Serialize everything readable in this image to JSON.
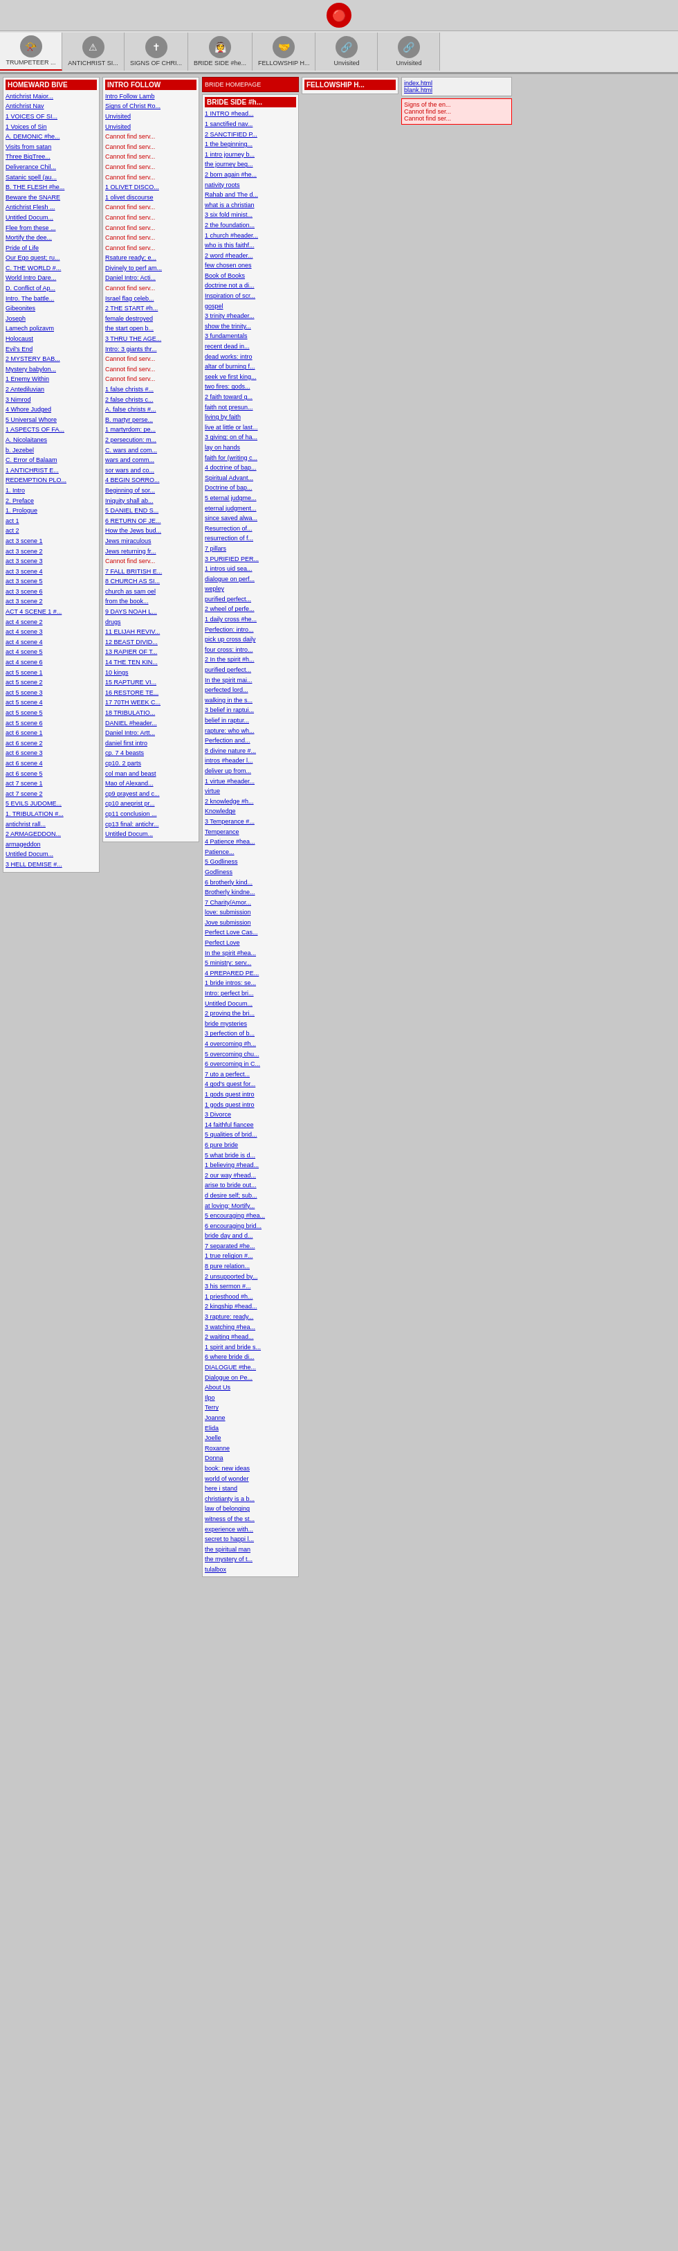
{
  "logo": {
    "symbol": "🔴"
  },
  "nav": {
    "items": [
      {
        "id": "trumpeteer",
        "label": "TRUMPETEER ...",
        "icon": "📯"
      },
      {
        "id": "antichrist",
        "label": "ANTICHRIST SI...",
        "icon": "⚠"
      },
      {
        "id": "signs",
        "label": "SIGNS OF CHRI...",
        "icon": "✝"
      },
      {
        "id": "bride_side",
        "label": "BRIDE SIDE #he...",
        "icon": "👰"
      },
      {
        "id": "fellowship",
        "label": "FELLOWSHIP H...",
        "icon": "🤝"
      },
      {
        "id": "unvisited1",
        "label": "Unvisited",
        "icon": "🔗"
      },
      {
        "id": "unvisited2",
        "label": "Unvisited",
        "icon": "🔗"
      }
    ]
  },
  "col1": {
    "header": "HOMEWARD BIVE",
    "items": [
      "Antichrist Maior...",
      "Antichrist Nav",
      "1 VOICES OF SI...",
      "1 Voices of Sin",
      "A. DEMONIC #he...",
      "Visits from satan",
      "Three BigTree...",
      "Deliverance Chil...",
      "Satanic spell (au...",
      "B. THE FLESH #he...",
      "Beware the SNARE",
      "Antichrist Flesh ...",
      "Untitled Docum...",
      "Flee from these ...",
      "Mortify the dee...",
      "Pride of Life",
      "Our Ego quest; ru...",
      "C. THE WORLD #...",
      "World Intro Dare...",
      "D. Conflict of Ap...",
      "Intro. The battle...",
      "Gibeonites",
      "Joseph",
      "Lamech polizavm",
      "Holocaust",
      "Evil's End",
      "2 MYSTERY BAB...",
      "Mystery babylon...",
      "1 Enemy Within",
      "2 Antediluvian",
      "3 Nimrod",
      "4 Whore Judged",
      "5 Universal Whore",
      "1 ASPECTS OF FA...",
      "A. Nicolaitanes",
      "b. Jezebel",
      "C. Error of Balaam",
      "1 ANTICHRIST E...",
      "REDEMPTION PLO...",
      "1. Intro",
      "2. Preface",
      "1. Prologue",
      "act 1",
      "act 2",
      "act 3 scene 1",
      "act 3 scene 2",
      "act 3 scene 3",
      "act 3 scene 4",
      "act 3 scene 5",
      "act 3 scene 6",
      "act 3 scene 2",
      "ACT 4 SCENE 1 #...",
      "act 4 scene 2",
      "act 4 scene 3",
      "act 4 scene 4",
      "act 4 scene 5",
      "act 4 scene 6",
      "act 5 scene 1",
      "act 5 scene 2",
      "act 5 scene 3",
      "act 5 scene 4",
      "act 5 scene 5",
      "act 5 scene 6",
      "act 6 scene 1",
      "act 6 scene 2",
      "act 6 scene 3",
      "act 6 scene 4",
      "act 6 scene 5",
      "act 7 scene 1",
      "act 7 scene 2",
      "5 EVILS JUDOME...",
      "1. TRIBULATION #...",
      "antichrist rall...",
      "2 ARMAGEDDON...",
      "armageddon",
      "Untitled Docum...",
      "3 HELL DEMISE #..."
    ]
  },
  "col2": {
    "header": "INTRO FOLLOW",
    "items": [
      "Intro Follow Lamb",
      "Signs of Christ Ro...",
      "Unvisited",
      "Unvisited",
      "Cannot find serv...",
      "Cannot find serv...",
      "Cannot find serv...",
      "Cannot find serv...",
      "Cannot find serv...",
      "1 OLIVET DISCO...",
      "1 olivet discourse",
      "Cannot find serv...",
      "Cannot find serv...",
      "Cannot find serv...",
      "Cannot find serv...",
      "Cannot find serv...",
      "Rsature ready; e...",
      "Divinely to perf am...",
      "Daniel Intro: Acti...",
      "Cannot find serv...",
      "Israel flag celeb...",
      "2 THE START #h...",
      "female destroyed",
      "the start open b...",
      "3 THRU THE AGE...",
      "Intro: 3 giants thr...",
      "Cannot find serv...",
      "Cannot find serv...",
      "Cannot find serv...",
      "1 false christs #...",
      "2 false christs c...",
      "A. false christs #...",
      "B. martyr perse...",
      "1 martyrdom: pe...",
      "2 persecution: m...",
      "C. wars and com...",
      "wars and comm...",
      "sor wars and co...",
      "4 BEGIN SORRO...",
      "Beginning of sor...",
      "Iniquity shall ab...",
      "5 DANIEL END S...",
      "6 RETURN OF JE...",
      "How the Jews bud...",
      "Jews miraculous",
      "Jews returning fr...",
      "Cannot find serv...",
      "7 FALL BRITISH E...",
      "8 CHURCH AS SI...",
      "church as sam oel",
      "from the book...",
      "9 DAYS NOAH L...",
      "drugs",
      "11 ELIJAH REVIV...",
      "12 BEAST DIVID...",
      "13 RAPIER OF T...",
      "14 THE TEN KIN...",
      "10 kings",
      "15 RAPTURE VI...",
      "16 RESTORE TE...",
      "17 70TH WEEK C...",
      "18 TRIBULATIO...",
      "DANIEL #header...",
      "Daniel Intro: Artt...",
      "daniel first intro",
      "cp. 7 4 beasts",
      "cp10. 2 parts",
      "col man and beast",
      "Mao of Alexand...",
      "cp9 prayest and c...",
      "cp10 aneprist pr...",
      "cp11 conclusion ...",
      "cp13 final: antichr...",
      "Untitled Docum..."
    ]
  },
  "col3": {
    "header": "BRIDE SIDE #h...",
    "header2": "BRIDE HOMEPAGE",
    "items": [
      "1 INTRO #head...",
      "1 sanctified nav...",
      "2 SANCTIFIED P...",
      "1 the beginning...",
      "1 intro journey b...",
      "the journey beg...",
      "2 born again #he...",
      "nativity roots",
      "Rahab and The d...",
      "what is a christian",
      "3 six fold minist...",
      "2 the foundation...",
      "1 church #header...",
      "who is this faithf...",
      "2 word #header...",
      "few chosen ones",
      "Book of Books",
      "doctrine not a di...",
      "Inspiration of scr...",
      "gospel",
      "3 trinity #header...",
      "show the trinity...",
      "3 fundamentals",
      "recent dead in...",
      "dead works: intro",
      "altar of burning f...",
      "seek ve first king...",
      "two fires: gods...",
      "2 faith toward g...",
      "faith not presun...",
      "living by faith",
      "live at little or last...",
      "3 giving: on of ha...",
      "lay on hands",
      "faith for (writing c...",
      "4 doctrine of bap...",
      "Spiritual Advant...",
      "Doctrine of bap...",
      "5 eternal judgme...",
      "eternal judgment...",
      "since saved alwa...",
      "Resurrection of...",
      "resurrection of f...",
      "7 pillars",
      "3 PURIFIED PER...",
      "1 intros uid sea...",
      "dialogue on perf...",
      "wepley",
      "purified perfect...",
      "2 wheel of perfe...",
      "1 daily cross #he...",
      "Perfection: intro...",
      "pick up cross daily",
      "four cross: intro...",
      "2 In the spirit #h...",
      "purified perfect...",
      "In the spirit mai...",
      "perfected lord...",
      "walking in the s...",
      "3 belief in raptui...",
      "belief in raptur...",
      "rapture: who wh...",
      "Perfection and...",
      "8 divine nature #...",
      "intros #header l...",
      "deliver up from...",
      "1 virtue #header...",
      "virtue",
      "2 knowledge #h...",
      "Knowledge",
      "3 Temperance #...",
      "Temperance",
      "4 Patience #hea...",
      "Patience...",
      "5 Godliness",
      "Godliness",
      "6 brotherly kind...",
      "Brotherly kindne...",
      "7 Charity/Amor...",
      "love: submission",
      "Jove submission",
      "Perfect Love Cas...",
      "Perfect Love",
      "In the spirit #hea...",
      "5 ministry: serv...",
      "4 PREPARED PE...",
      "1 bride intros: se...",
      "Intro: perfect bri...",
      "Untitled Docum...",
      "2 proving the bri...",
      "bride mysteries",
      "3 perfection of b...",
      "4 overcoming #h...",
      "5 overcoming chu...",
      "6 overcoming in C...",
      "7 uto a perfect...",
      "4 god's quest for...",
      "1 gods quest intro",
      "1 gods quest intro",
      "3 Divorce",
      "14 faithful fiancee",
      "5 qualities of brid...",
      "6 pure bride",
      "5 what bride is d...",
      "1 believing #head...",
      "2 our way #head...",
      "arise to bride out...",
      "d desire self; sub...",
      "at loving: Mortify...",
      "5 encouraging #hea...",
      "6 encouraging brid...",
      "bride day and d...",
      "7 separated #he...",
      "1 true religion #...",
      "8 pure relation...",
      "2 unsupported by...",
      "3 his sermon #...",
      "1 priesthood #h...",
      "2 kingship #head...",
      "3 rapture: ready...",
      "3 watching #hea...",
      "2 waiting #head...",
      "1 spirit and bride s...",
      "6 where bride di...",
      "DIALOGUE #the...",
      "Dialogue on Pe...",
      "About Us",
      "Ilpo",
      "Terry",
      "Joanne",
      "Elida",
      "Joelle",
      "Roxanne",
      "Donna",
      "book: new ideas",
      "world of wonder",
      "here i stand",
      "christianty is a b...",
      "law of belonging",
      "witness of the st...",
      "experience with...",
      "secret to happi l...",
      "the spiritual man",
      "the mystery of t...",
      "tulalbox"
    ]
  },
  "col4": {
    "header": "FELLOWSHIP H...",
    "items": []
  },
  "right_panel": {
    "files": [
      {
        "name": "index.html",
        "type": "link"
      },
      {
        "name": "blank.html",
        "type": "link"
      }
    ],
    "errors": [
      "Signs of the en...",
      "Cannot find ser...",
      "Cannot find ser..."
    ]
  },
  "errors": {
    "cannot_find": "Cannot find serv _"
  }
}
